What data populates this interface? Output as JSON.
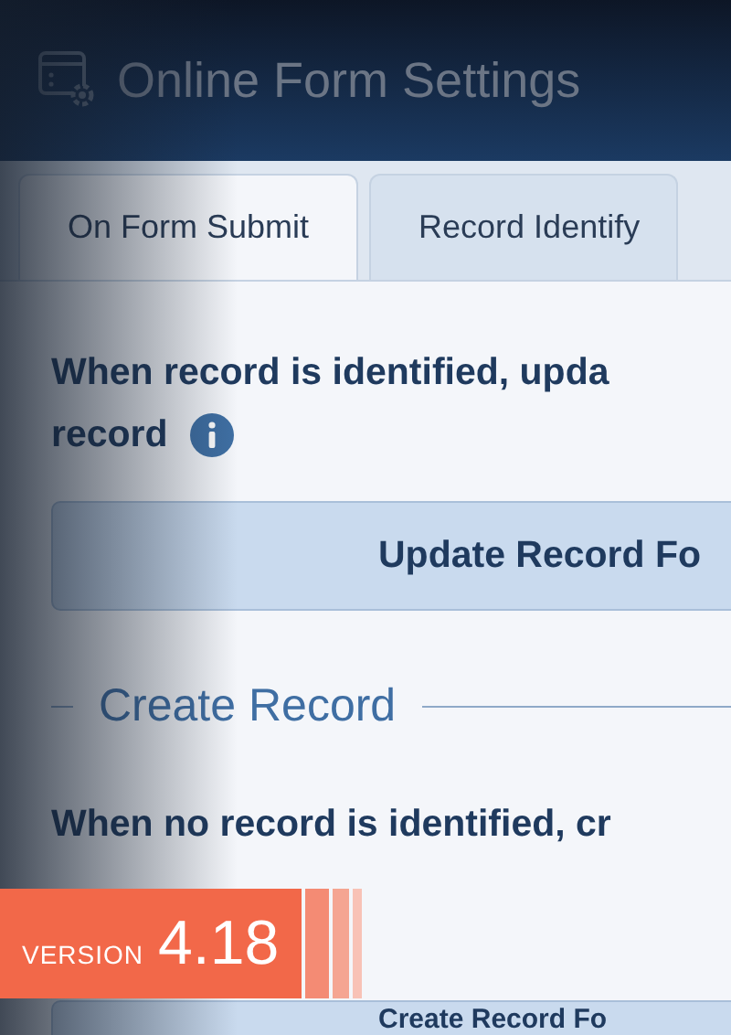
{
  "window": {
    "title": "Online Form Settings"
  },
  "tabs": [
    {
      "label": "On Form Submit",
      "selected": true
    },
    {
      "label": "Record Identify",
      "selected": false
    }
  ],
  "update_section": {
    "description": "When record is identified, upda",
    "description_line_2": "record",
    "button": "Update Record Fo"
  },
  "create_section": {
    "legend": "Create Record",
    "description": "When no record is identified, cr",
    "button": "Create Record Fo"
  },
  "version_badge": {
    "label": "VERSION",
    "number": "4.18"
  }
}
